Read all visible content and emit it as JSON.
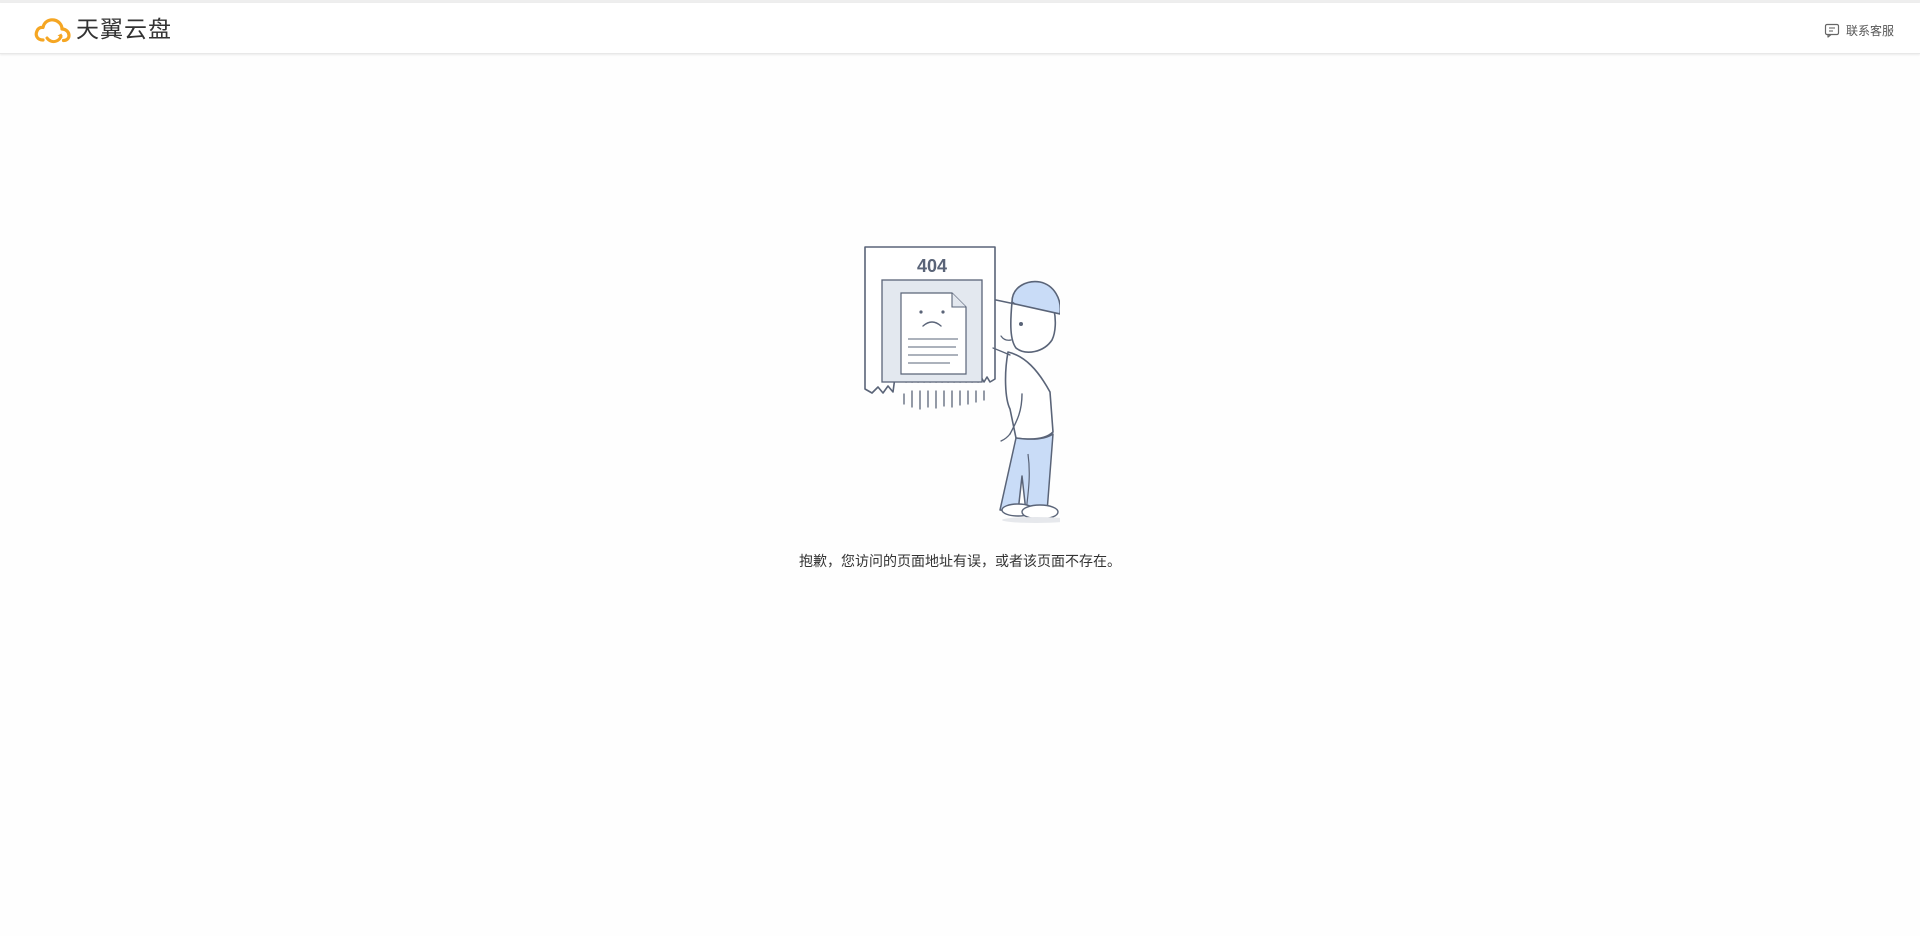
{
  "header": {
    "logo_text": "天翼云盘",
    "support_label": "联系客服",
    "support_icon": "chat-icon"
  },
  "illustration": {
    "code_text": "404",
    "icon": "error-404-illustration"
  },
  "main": {
    "message": "抱歉，您访问的页面地址有误，或者该页面不存在。"
  },
  "colors": {
    "brand_orange": "#f5a623",
    "stroke": "#5a6478",
    "fill_blue": "#c9dcf7",
    "fill_gray": "#e3e8ef"
  }
}
